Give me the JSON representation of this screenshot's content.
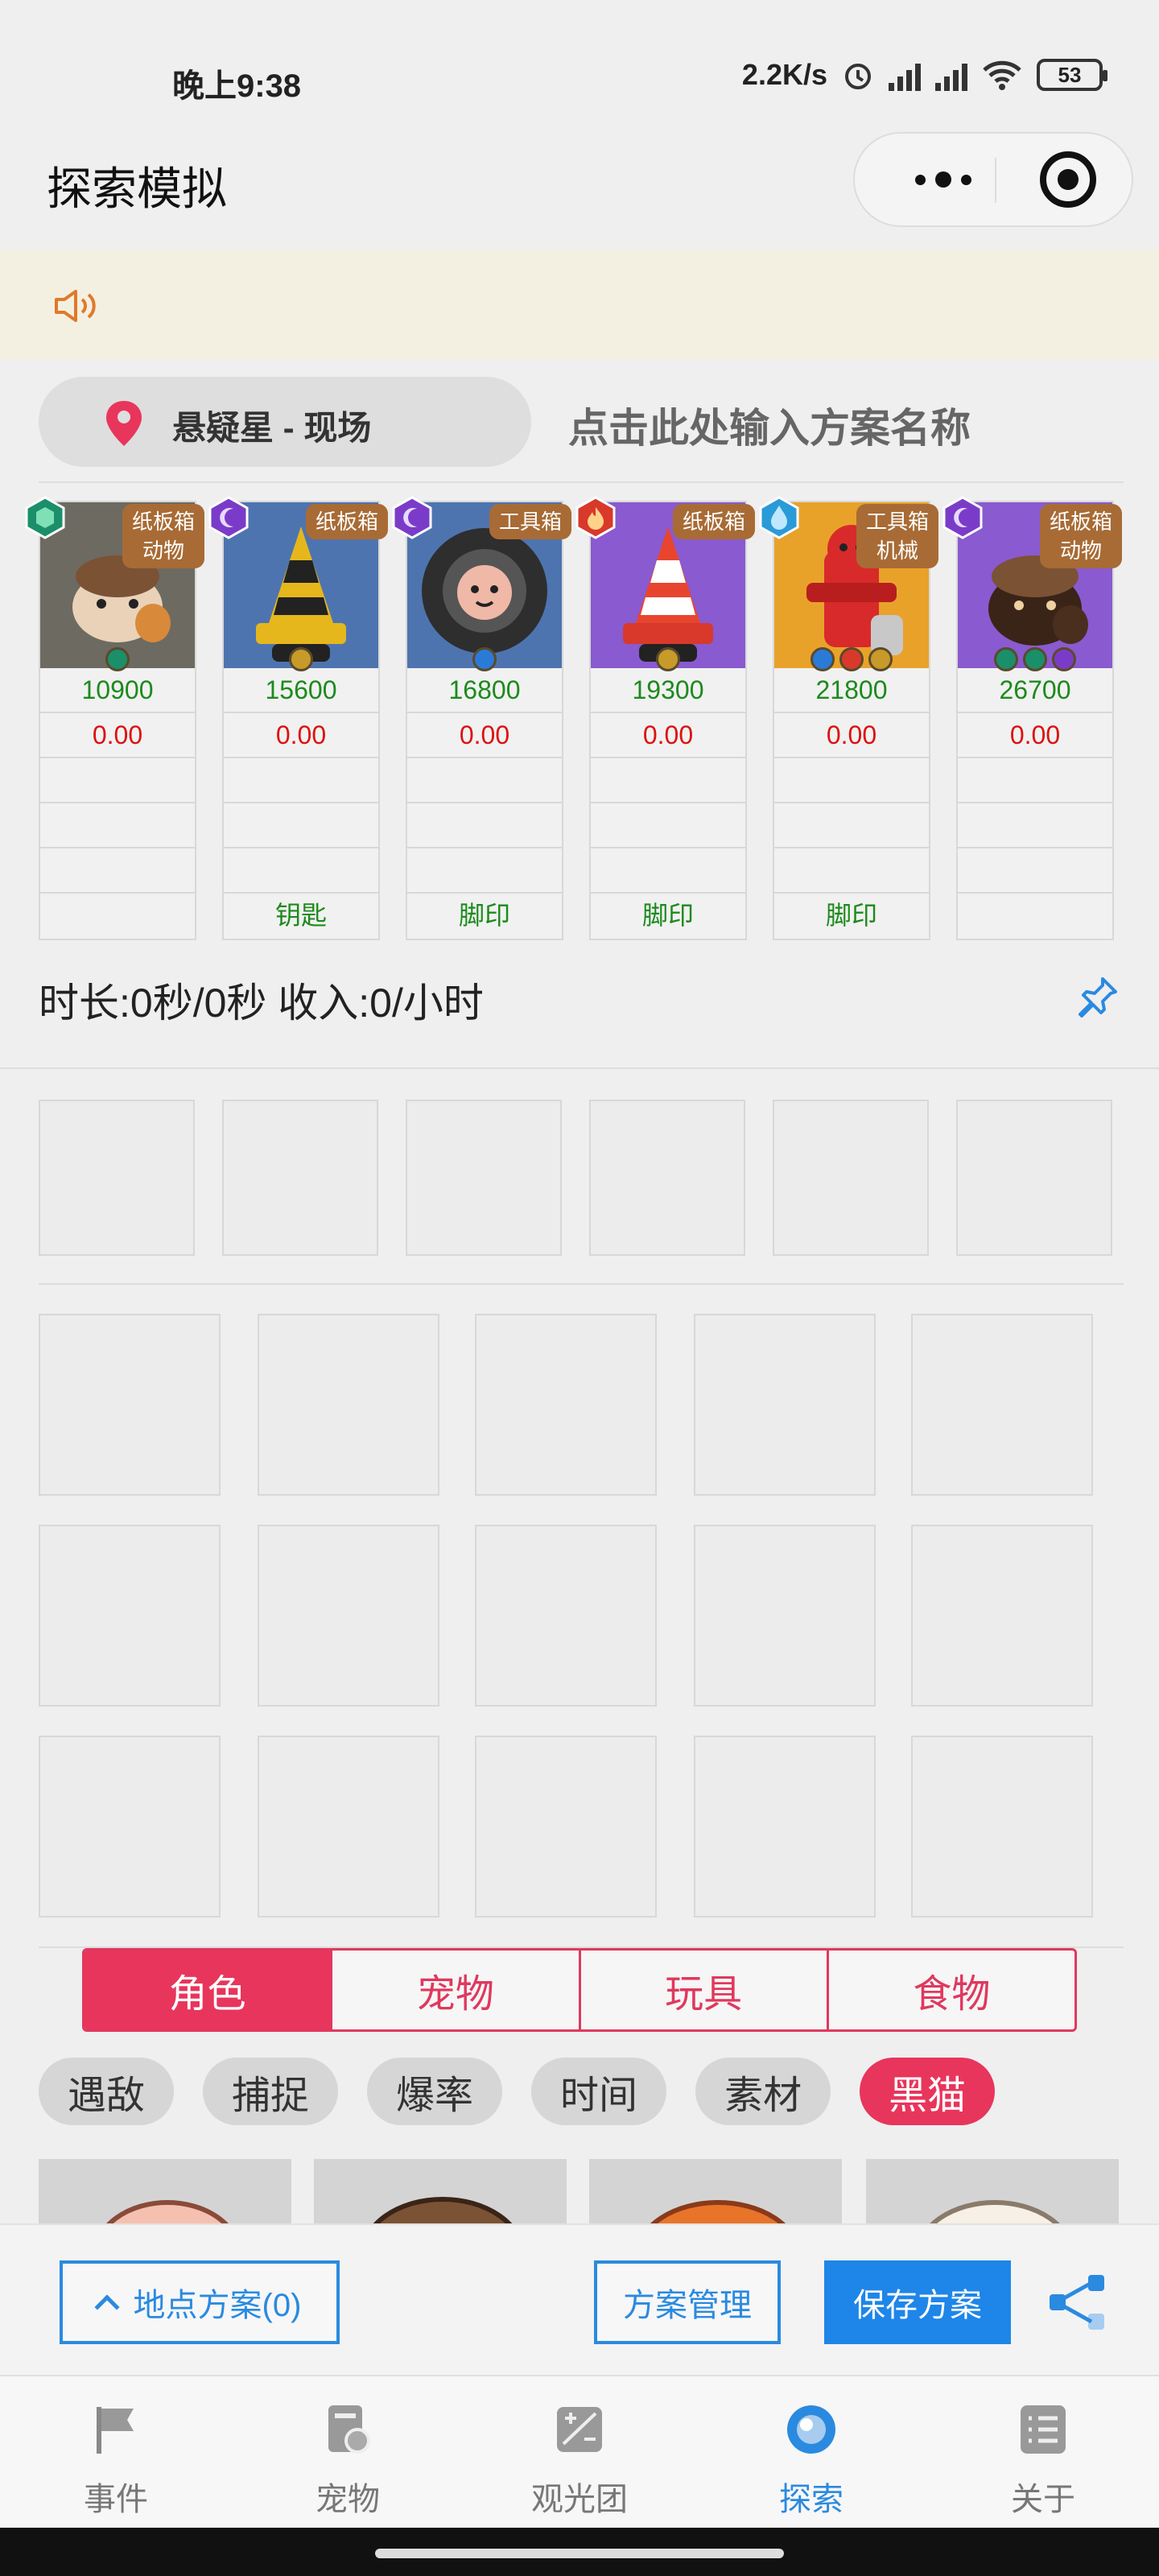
{
  "status_bar": {
    "time": "晚上9:38",
    "net_speed": "2.2K/s",
    "battery": "53"
  },
  "header": {
    "title": "探索模拟"
  },
  "location": {
    "name": "悬疑星 - 现场",
    "plan_placeholder": "点击此处输入方案名称"
  },
  "enemies": [
    {
      "element_color": "#1a8f6a",
      "tag": "纸板箱\n动物",
      "hp": "10900",
      "value": "0.00",
      "drop": ""
    },
    {
      "element_color": "#7a3cc8",
      "tag": "纸板箱",
      "hp": "15600",
      "value": "0.00",
      "drop": "钥匙"
    },
    {
      "element_color": "#7a3cc8",
      "tag": "工具箱",
      "hp": "16800",
      "value": "0.00",
      "drop": "脚印"
    },
    {
      "element_color": "#d8392b",
      "tag": "纸板箱",
      "hp": "19300",
      "value": "0.00",
      "drop": "脚印"
    },
    {
      "element_color": "#2a9ad8",
      "tag": "工具箱\n机械",
      "hp": "21800",
      "value": "0.00",
      "drop": "脚印"
    },
    {
      "element_color": "#7a3cc8",
      "tag": "纸板箱\n动物",
      "hp": "26700",
      "value": "0.00",
      "drop": ""
    }
  ],
  "stats": {
    "text": "时长:0秒/0秒 收入:0/小时"
  },
  "segments": {
    "items": [
      "角色",
      "宠物",
      "玩具",
      "食物"
    ],
    "active": 0
  },
  "chips": {
    "items": [
      "遇敌",
      "捕捉",
      "爆率",
      "时间",
      "素材",
      "黑猫"
    ],
    "active": 5
  },
  "actions": {
    "location_plans": "地点方案(0)",
    "plan_manage": "方案管理",
    "save_plan": "保存方案"
  },
  "tabbar": {
    "items": [
      "事件",
      "宠物",
      "观光团",
      "探索",
      "关于"
    ],
    "active": 3
  },
  "colors": {
    "accent_red": "#e8355c",
    "accent_blue": "#1e86e8",
    "hp_green": "#1c8a1c",
    "value_red": "#dd1111"
  }
}
